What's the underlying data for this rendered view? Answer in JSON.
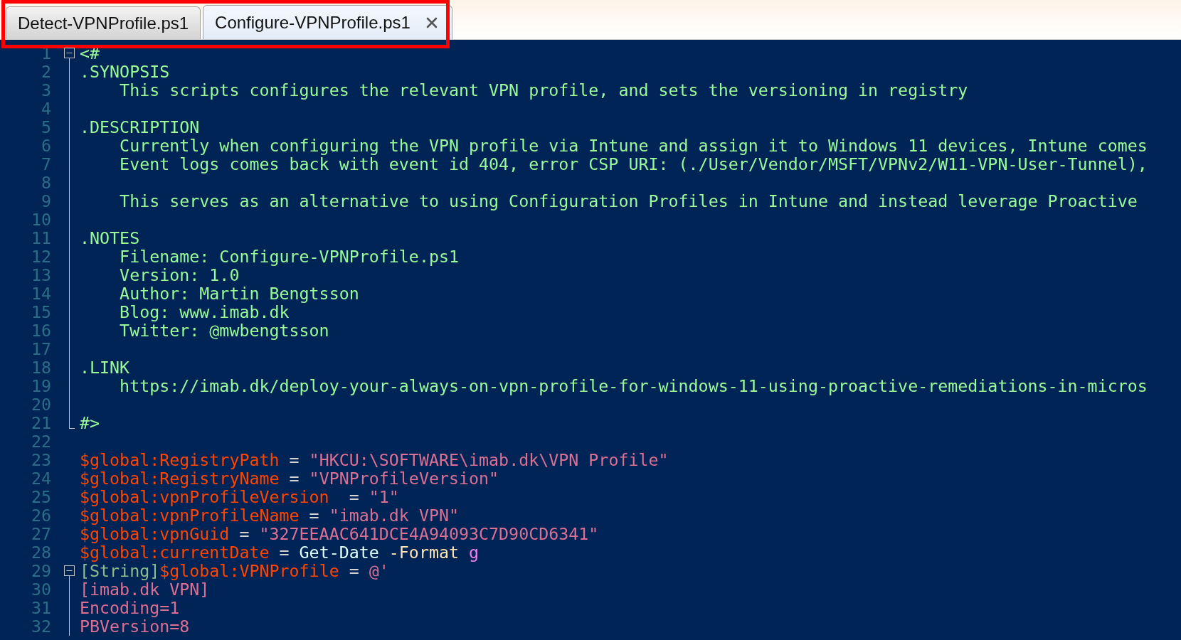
{
  "tabs": [
    {
      "label": "Detect-VPNProfile.ps1",
      "selected": false
    },
    {
      "label": "Configure-VPNProfile.ps1",
      "selected": true
    }
  ],
  "tabs_highlighted": true,
  "lines": [
    {
      "number": "1",
      "fold": {
        "kind": "start"
      },
      "tokens": [
        {
          "kind": "comment",
          "text": "<#"
        }
      ]
    },
    {
      "number": "2",
      "fold": {
        "kind": "body"
      },
      "tokens": [
        {
          "kind": "comment",
          "text": ".SYNOPSIS"
        }
      ]
    },
    {
      "number": "3",
      "fold": {
        "kind": "body"
      },
      "tokens": [
        {
          "kind": "comment",
          "text": "    This scripts configures the relevant VPN profile, and sets the versioning in registry"
        }
      ]
    },
    {
      "number": "4",
      "fold": {
        "kind": "body"
      }
    },
    {
      "number": "5",
      "fold": {
        "kind": "body"
      },
      "tokens": [
        {
          "kind": "comment",
          "text": ".DESCRIPTION"
        }
      ]
    },
    {
      "number": "6",
      "fold": {
        "kind": "body"
      },
      "tokens": [
        {
          "kind": "comment",
          "text": "    Currently when configuring the VPN profile via Intune and assign it to Windows 11 devices, Intune comes"
        }
      ]
    },
    {
      "number": "7",
      "fold": {
        "kind": "body"
      },
      "tokens": [
        {
          "kind": "comment",
          "text": "    Event logs comes back with event id 404, error CSP URI: (./User/Vendor/MSFT/VPNv2/W11-VPN-User-Tunnel),"
        }
      ]
    },
    {
      "number": "8",
      "fold": {
        "kind": "body"
      }
    },
    {
      "number": "9",
      "fold": {
        "kind": "body"
      },
      "tokens": [
        {
          "kind": "comment",
          "text": "    This serves as an alternative to using Configuration Profiles in Intune and instead leverage Proactive"
        }
      ]
    },
    {
      "number": "10",
      "fold": {
        "kind": "body"
      }
    },
    {
      "number": "11",
      "fold": {
        "kind": "body"
      },
      "tokens": [
        {
          "kind": "comment",
          "text": ".NOTES"
        }
      ]
    },
    {
      "number": "12",
      "fold": {
        "kind": "body"
      },
      "tokens": [
        {
          "kind": "comment",
          "text": "    Filename: Configure-VPNProfile.ps1"
        }
      ]
    },
    {
      "number": "13",
      "fold": {
        "kind": "body"
      },
      "tokens": [
        {
          "kind": "comment",
          "text": "    Version: 1.0"
        }
      ]
    },
    {
      "number": "14",
      "fold": {
        "kind": "body"
      },
      "tokens": [
        {
          "kind": "comment",
          "text": "    Author: Martin Bengtsson"
        }
      ]
    },
    {
      "number": "15",
      "fold": {
        "kind": "body"
      },
      "tokens": [
        {
          "kind": "comment",
          "text": "    Blog: www.imab.dk"
        }
      ]
    },
    {
      "number": "16",
      "fold": {
        "kind": "body"
      },
      "tokens": [
        {
          "kind": "comment",
          "text": "    Twitter: @mwbengtsson"
        }
      ]
    },
    {
      "number": "17",
      "fold": {
        "kind": "body"
      }
    },
    {
      "number": "18",
      "fold": {
        "kind": "body"
      },
      "tokens": [
        {
          "kind": "comment",
          "text": ".LINK"
        }
      ]
    },
    {
      "number": "19",
      "fold": {
        "kind": "body"
      },
      "tokens": [
        {
          "kind": "comment",
          "text": "    https://imab.dk/deploy-your-always-on-vpn-profile-for-windows-11-using-proactive-remediations-in-micros"
        }
      ]
    },
    {
      "number": "20",
      "fold": {
        "kind": "body"
      }
    },
    {
      "number": "21",
      "fold": {
        "kind": "end"
      },
      "tokens": [
        {
          "kind": "comment",
          "text": "#>"
        }
      ]
    },
    {
      "number": "22"
    },
    {
      "number": "23",
      "tokens": [
        {
          "kind": "variable",
          "text": "$global:RegistryPath"
        },
        {
          "kind": "operator",
          "text": " = "
        },
        {
          "kind": "string",
          "text": "\"HKCU:\\SOFTWARE\\imab.dk\\VPN Profile\""
        }
      ]
    },
    {
      "number": "24",
      "tokens": [
        {
          "kind": "variable",
          "text": "$global:RegistryName"
        },
        {
          "kind": "operator",
          "text": " = "
        },
        {
          "kind": "string",
          "text": "\"VPNProfileVersion\""
        }
      ]
    },
    {
      "number": "25",
      "tokens": [
        {
          "kind": "variable",
          "text": "$global:vpnProfileVersion"
        },
        {
          "kind": "operator",
          "text": "  = "
        },
        {
          "kind": "string",
          "text": "\"1\""
        }
      ]
    },
    {
      "number": "26",
      "tokens": [
        {
          "kind": "variable",
          "text": "$global:vpnProfileName"
        },
        {
          "kind": "operator",
          "text": " = "
        },
        {
          "kind": "string",
          "text": "\"imab.dk VPN\""
        }
      ]
    },
    {
      "number": "27",
      "tokens": [
        {
          "kind": "variable",
          "text": "$global:vpnGuid"
        },
        {
          "kind": "operator",
          "text": " = "
        },
        {
          "kind": "string",
          "text": "\"327EEAAC641DCE4A94093C7D90CD6341\""
        }
      ]
    },
    {
      "number": "28",
      "tokens": [
        {
          "kind": "variable",
          "text": "$global:currentDate"
        },
        {
          "kind": "operator",
          "text": " = "
        },
        {
          "kind": "command",
          "text": "Get-Date "
        },
        {
          "kind": "parameter",
          "text": "-Format "
        },
        {
          "kind": "argument",
          "text": "g"
        }
      ]
    },
    {
      "number": "29",
      "fold": {
        "kind": "start"
      },
      "tokens": [
        {
          "kind": "type",
          "text": "[String]"
        },
        {
          "kind": "variable",
          "text": "$global:VPNProfile"
        },
        {
          "kind": "operator",
          "text": " = "
        },
        {
          "kind": "string",
          "text": "@'"
        }
      ]
    },
    {
      "number": "30",
      "fold": {
        "kind": "body"
      },
      "tokens": [
        {
          "kind": "string",
          "text": "[imab.dk VPN]"
        }
      ]
    },
    {
      "number": "31",
      "fold": {
        "kind": "body"
      },
      "tokens": [
        {
          "kind": "string",
          "text": "Encoding=1"
        }
      ]
    },
    {
      "number": "32",
      "fold": {
        "kind": "body"
      },
      "tokens": [
        {
          "kind": "string",
          "text": "PBVersion=8"
        }
      ]
    }
  ]
}
